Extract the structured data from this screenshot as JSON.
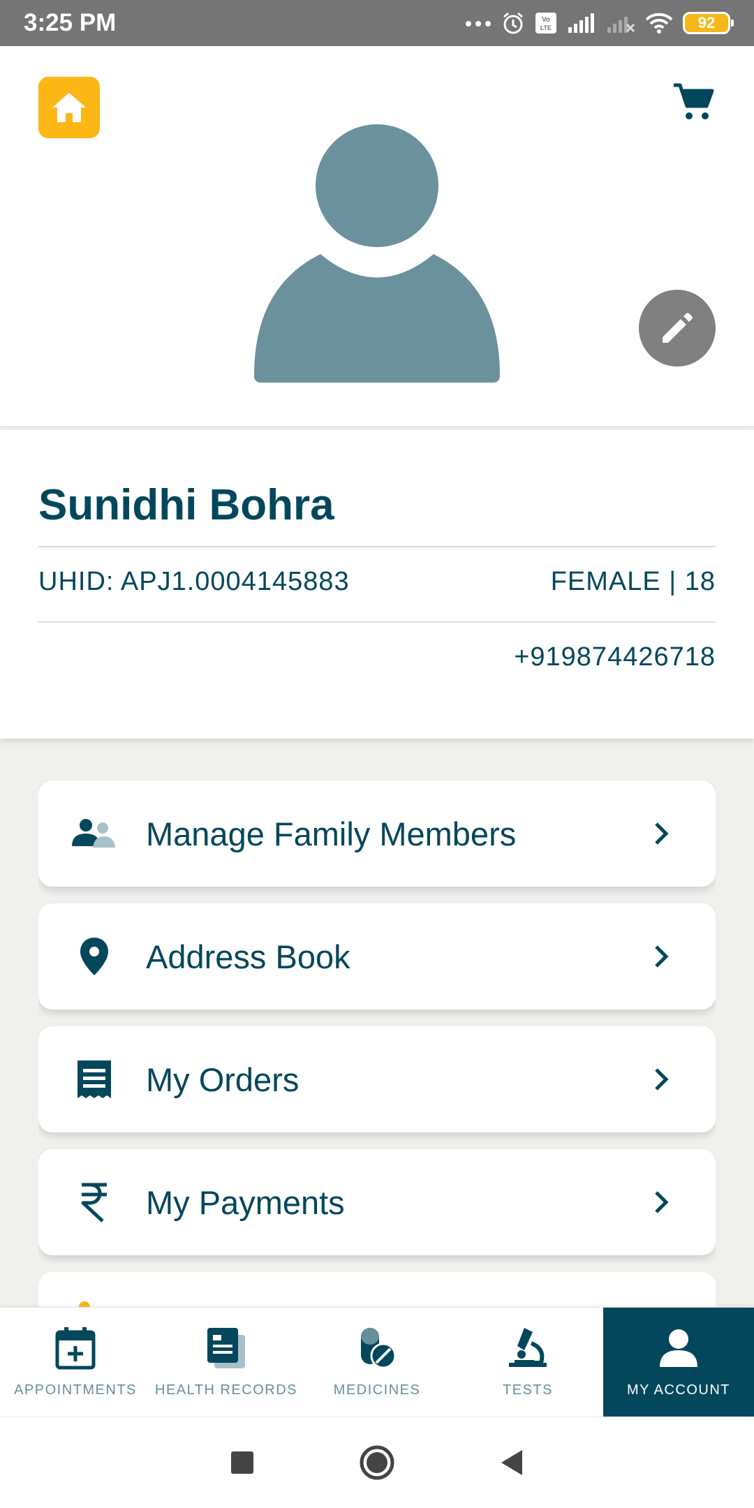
{
  "status_bar": {
    "time": "3:25 PM",
    "battery": "92"
  },
  "profile": {
    "name": "Sunidhi Bohra",
    "uhid": "UHID: APJ1.0004145883",
    "gender_age": "FEMALE | 18",
    "phone": "+919874426718"
  },
  "menu": [
    {
      "label": "Manage Family Members",
      "icon": "family-icon"
    },
    {
      "label": "Address Book",
      "icon": "location-pin-icon"
    },
    {
      "label": "My Orders",
      "icon": "receipt-icon"
    },
    {
      "label": "My Payments",
      "icon": "rupee-icon"
    }
  ],
  "bottom_nav": [
    {
      "label": "APPOINTMENTS",
      "icon": "calendar-plus-icon",
      "active": false
    },
    {
      "label": "HEALTH RECORDS",
      "icon": "records-icon",
      "active": false
    },
    {
      "label": "MEDICINES",
      "icon": "pill-icon",
      "active": false
    },
    {
      "label": "TESTS",
      "icon": "microscope-icon",
      "active": false
    },
    {
      "label": "MY ACCOUNT",
      "icon": "person-icon",
      "active": true
    }
  ],
  "colors": {
    "primary": "#02475b",
    "accent": "#fcb716",
    "avatar": "#6a919c",
    "inactive_nav": "#658f9b"
  }
}
